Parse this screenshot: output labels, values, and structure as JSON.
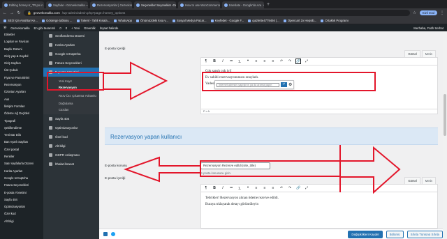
{
  "browser": {
    "tabs": [
      {
        "title": "Editing homey-tr_TR.po in I",
        "active": false
      },
      {
        "title": "Sayfalar ‹ Gezvekonakla — W",
        "active": false
      },
      {
        "title": "Rezervasyonlar | Gezvekonakla",
        "active": false
      },
      {
        "title": "Seçenekler Seçenekler ‹Gez",
        "active": true
      },
      {
        "title": "How to use WooCommerce",
        "active": false
      },
      {
        "title": "translate - Google'da Ara",
        "active": false
      }
    ],
    "new_tab": "+",
    "url_host": "gezvekonakla.com",
    "url_path": "/wp-admin/admin.php?page=homey_options",
    "profile": "Gizli mod",
    "bookmarks": [
      "SEO İçin Anahtar Ke...",
      "Gösterge tablosu ...",
      "Tokenl - Tahli Kısala...",
      "WhatsApp",
      "Önümüzdeki kısa v...",
      "Sosyal Medya Pazar...",
      "Keyfedet - Google F...",
      "quizlette4779494 |...",
      "Opencart 2x Hepsib...",
      "Ortaklık Programı"
    ]
  },
  "adminbar": {
    "site": "Gezvekonakla",
    "items": [
      "En gibi tasarımlı",
      "0",
      "0",
      "+ Yeni",
      "Güvenlik",
      "İnşaat halinde"
    ],
    "user": "Merhaba, Fatih Serhat"
  },
  "sidebar": {
    "items": [
      "Etiketler",
      "Logolar ve Favicon",
      "Başlık Düzeni",
      "Giriş yap & Kaydol",
      "Giriş Sayfası",
      "Üst Çubuk",
      "Fiyat ve Para Birimi",
      "Rezervasyon",
      "Üzüntan Ayarları",
      "Aus",
      "İletişim Formları",
      "Ödeme Ağ Geçitleri",
      "Tipografi",
      "Şekillendirme",
      "Yeni Bar Dilo",
      "Ban Ayarlı Sayfası",
      "Özel postal",
      "Renkler",
      "Satır sayfalarla Düzeni",
      "Harita Ayarları",
      "Google reCaptcha",
      "Fatura Seçenekleri",
      "E-posta Yönetimi",
      "Sayfa 404",
      "Optimizasyonlar",
      "Özel kod",
      "Alt bilgi"
    ]
  },
  "submenu": {
    "items": [
      {
        "label": "Sınıflandırma Düzeni",
        "current": false
      },
      {
        "label": "Harita Ayarları",
        "current": false
      },
      {
        "label": "Google reCaptcha",
        "current": false
      },
      {
        "label": "Fatura Seçenekleri",
        "current": false
      },
      {
        "label": "E-posta Yönetimi",
        "current": true
      }
    ],
    "sub_items": [
      {
        "label": "Yeni Kayıt",
        "bold": false
      },
      {
        "label": "Rezervasyon",
        "bold": true
      },
      {
        "label": "Rezv Ücr. Çıkartma Yükümlü",
        "bold": false
      },
      {
        "label": "Doğrulama",
        "bold": false
      },
      {
        "label": "Cüzdan",
        "bold": false
      }
    ],
    "items_after": [
      "Sayfa 404",
      "Optimizasyonlar",
      "Özel kod",
      "Alt bilgi",
      "GDPR Anlaşması",
      "İthalat ihracat"
    ]
  },
  "editor1": {
    "label": "E-posta İçeriği",
    "tab_visual": "Görsel",
    "tab_text": "Metin",
    "line1": "Çok şanslı çok iyi!",
    "line2": "Ev sahibi rezervasyonunuzu onayladı.",
    "line3_prefix": "Vadesi dolan ödemeyi tamamlayın ",
    "line3_highlight": "Şimdi Öde",
    "statusbar": "P » A",
    "link_placeholder": "İnternet adresini yapıştırın ya da arama yapın"
  },
  "section": {
    "title": "Rezervasyon yapan kullanıcı"
  },
  "subject_field": {
    "label": "E-posta konusu",
    "value": "Rezervasyon Rezerve edildi (site_title)",
    "description": "E-posta konusunu girin."
  },
  "editor2": {
    "label": "E-posta İçeriği",
    "tab_visual": "Görsel",
    "tab_text": "Metin",
    "line1": "Tebrikler! Rezervasyon alınan ödeme rezerve edildi.",
    "line2": "Buraya tıklayarak detayı görüntüleyin"
  },
  "footer": {
    "save": "Değişiklikleri Kaydet",
    "reset_section": "Bölümü",
    "reset_all": "Sıfırla Tümünü Sıfırla"
  },
  "colors": {
    "annotation_red": "#e3162b",
    "accent": "#2271b1"
  }
}
